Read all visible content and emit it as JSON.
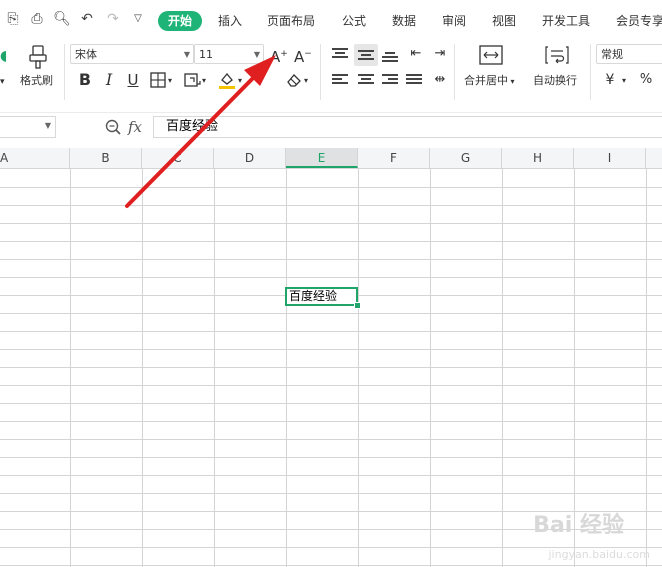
{
  "menu": {
    "tabs": [
      "开始",
      "插入",
      "页面布局",
      "公式",
      "数据",
      "审阅",
      "视图",
      "开发工具",
      "会员专享"
    ]
  },
  "ribbon": {
    "format_painter_label": "格式刷",
    "font_name": "宋体",
    "font_size": "11",
    "bold": "B",
    "italic": "I",
    "underline": "U",
    "merge_center_label": "合并居中",
    "wrap_text_label": "自动换行",
    "number_format": "常规",
    "currency_symbol": "¥",
    "percent_symbol": "%",
    "font_grow": "A⁺",
    "font_shrink": "A⁻"
  },
  "formula_bar": {
    "fx_label": "fx",
    "content": "百度经验"
  },
  "columns": [
    "A",
    "B",
    "C",
    "D",
    "E",
    "F",
    "G",
    "H",
    "I"
  ],
  "selected_column": "E",
  "active_cell": {
    "value": "百度经验"
  },
  "colors": {
    "accent": "#1fb477",
    "selection": "#1fa569",
    "arrow": "#e02020"
  },
  "watermark": {
    "brand": "Bai 经验",
    "url": "jingyan.baidu.com"
  }
}
